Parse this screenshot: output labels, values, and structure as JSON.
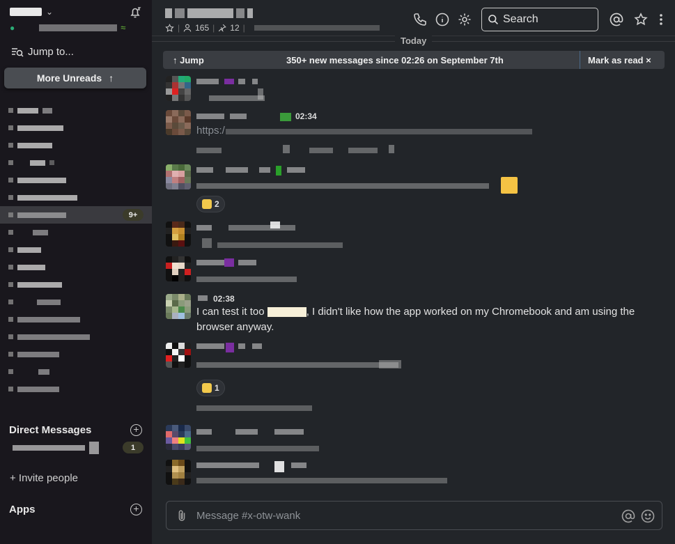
{
  "sidebar": {
    "jump_to": "Jump to...",
    "more_unreads": "More Unreads",
    "channels_unread_badge": "9+",
    "direct_messages_title": "Direct Messages",
    "dm_badge": "1",
    "invite_people": "+ Invite people",
    "apps_title": "Apps"
  },
  "header": {
    "members_count": "165",
    "pinned_count": "12",
    "search_label": "Search"
  },
  "feed": {
    "today_label": "Today",
    "banner": {
      "jump_label": "↑ Jump",
      "new_messages_text": "350+ new messages since 02:26 on September 7th",
      "mark_as_read": "Mark as read ×"
    },
    "messages": [
      {
        "time": "",
        "link_prefix": ""
      },
      {
        "time": "02:34",
        "link_prefix": "https:/"
      },
      {
        "time": "",
        "reaction_count": "2"
      },
      {
        "time": ""
      },
      {
        "time": ""
      },
      {
        "time": "02:38",
        "text_before": "I can test it too ",
        "text_after": ", I didn't like how the app worked on my Chromebook and am using the browser anyway."
      },
      {
        "time": "",
        "reaction_count": "1"
      },
      {
        "time": ""
      },
      {
        "time": ""
      }
    ]
  },
  "composer": {
    "placeholder": "Message #x-otw-wank"
  },
  "colors": {
    "sidebar_bg": "#19171d",
    "main_bg": "#222529",
    "presence_green": "#2bac76"
  }
}
